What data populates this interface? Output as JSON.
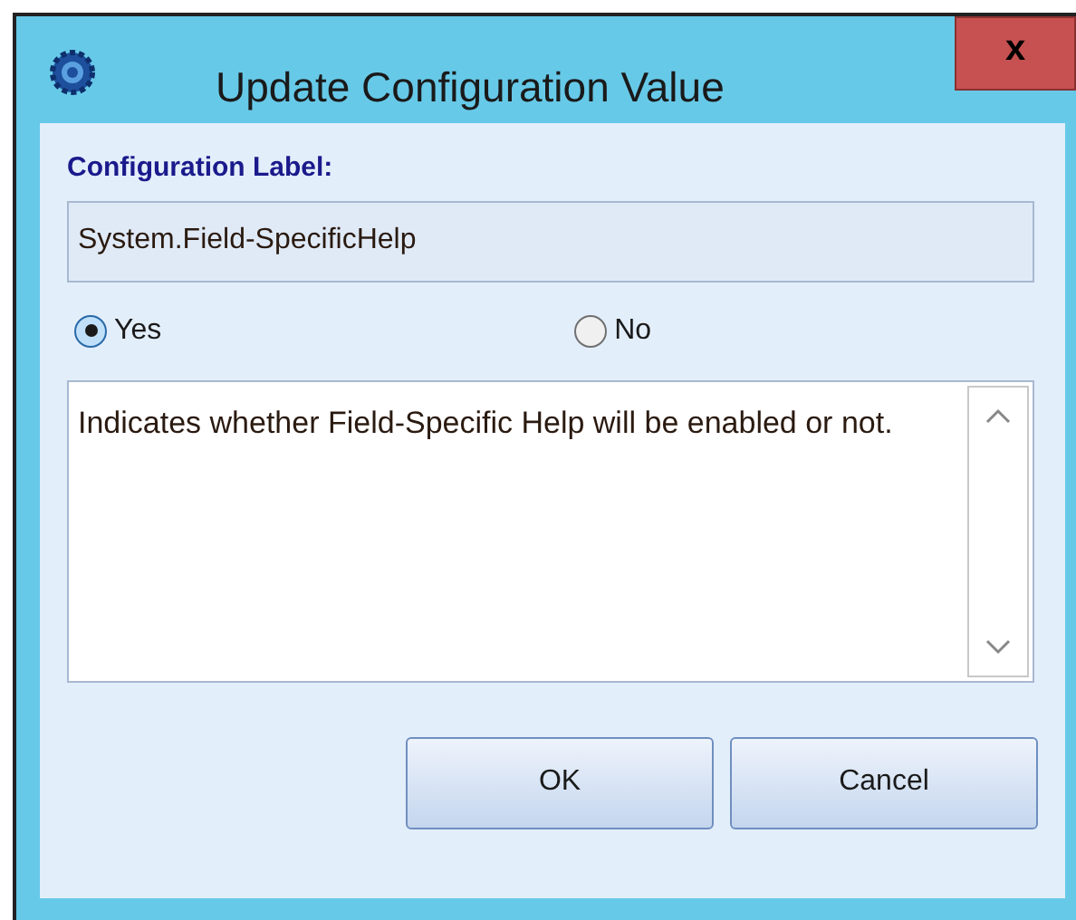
{
  "window": {
    "title": "Update Configuration Value",
    "close": "x"
  },
  "label": "Configuration Label:",
  "field": {
    "value": "System.Field-SpecificHelp"
  },
  "options": [
    {
      "label": "Yes",
      "selected": true
    },
    {
      "label": "No",
      "selected": false
    }
  ],
  "description": "Indicates whether Field-Specific Help will be enabled or not.",
  "buttons": [
    "OK",
    "Cancel"
  ]
}
